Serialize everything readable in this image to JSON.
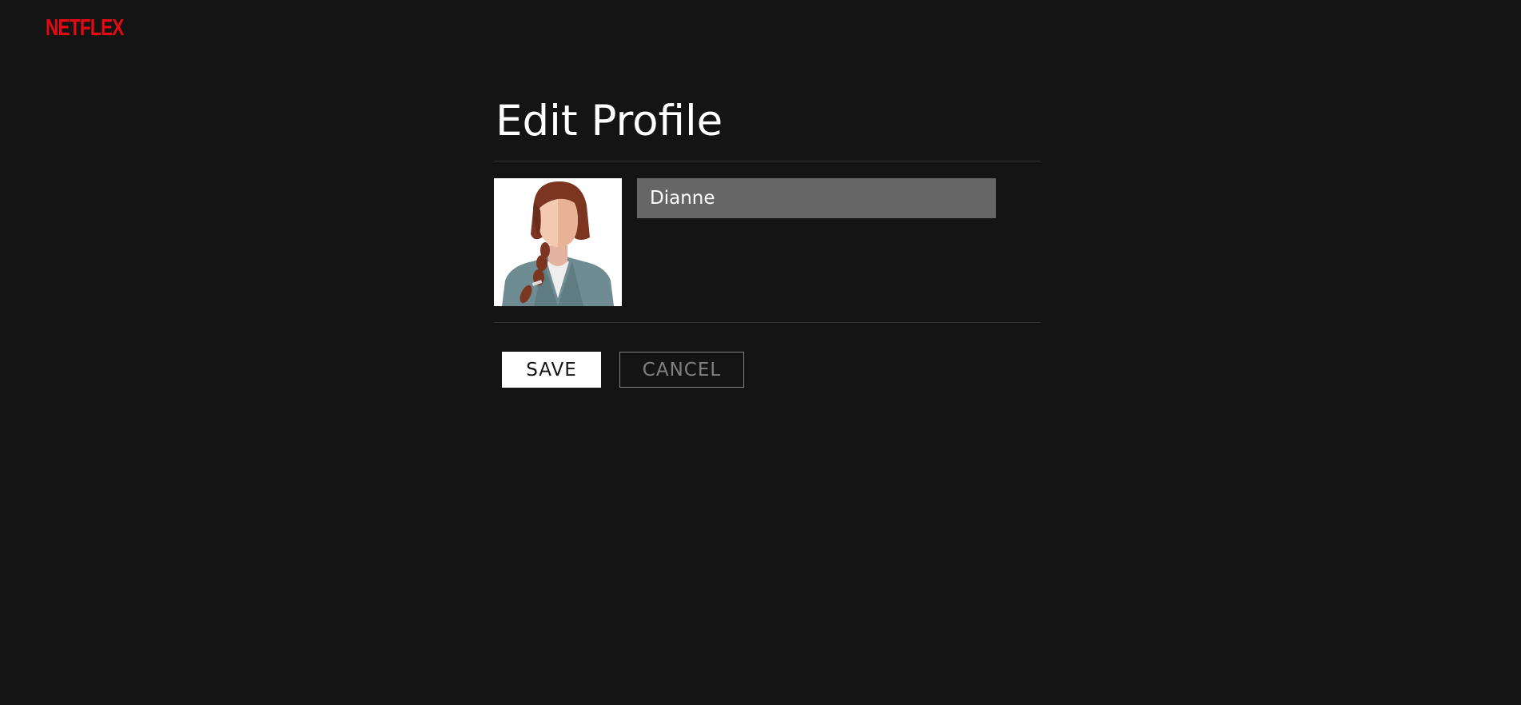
{
  "header": {
    "logo_text": "NETFLEX"
  },
  "edit_profile": {
    "title": "Edit Profile",
    "avatar_icon": "woman-avatar-icon",
    "name_input_value": "Dianne"
  },
  "actions": {
    "save_label": "SAVE",
    "cancel_label": "CANCEL"
  },
  "colors": {
    "background": "#141414",
    "brand_red": "#e50914",
    "input_bg": "#666666",
    "divider": "#333333"
  }
}
